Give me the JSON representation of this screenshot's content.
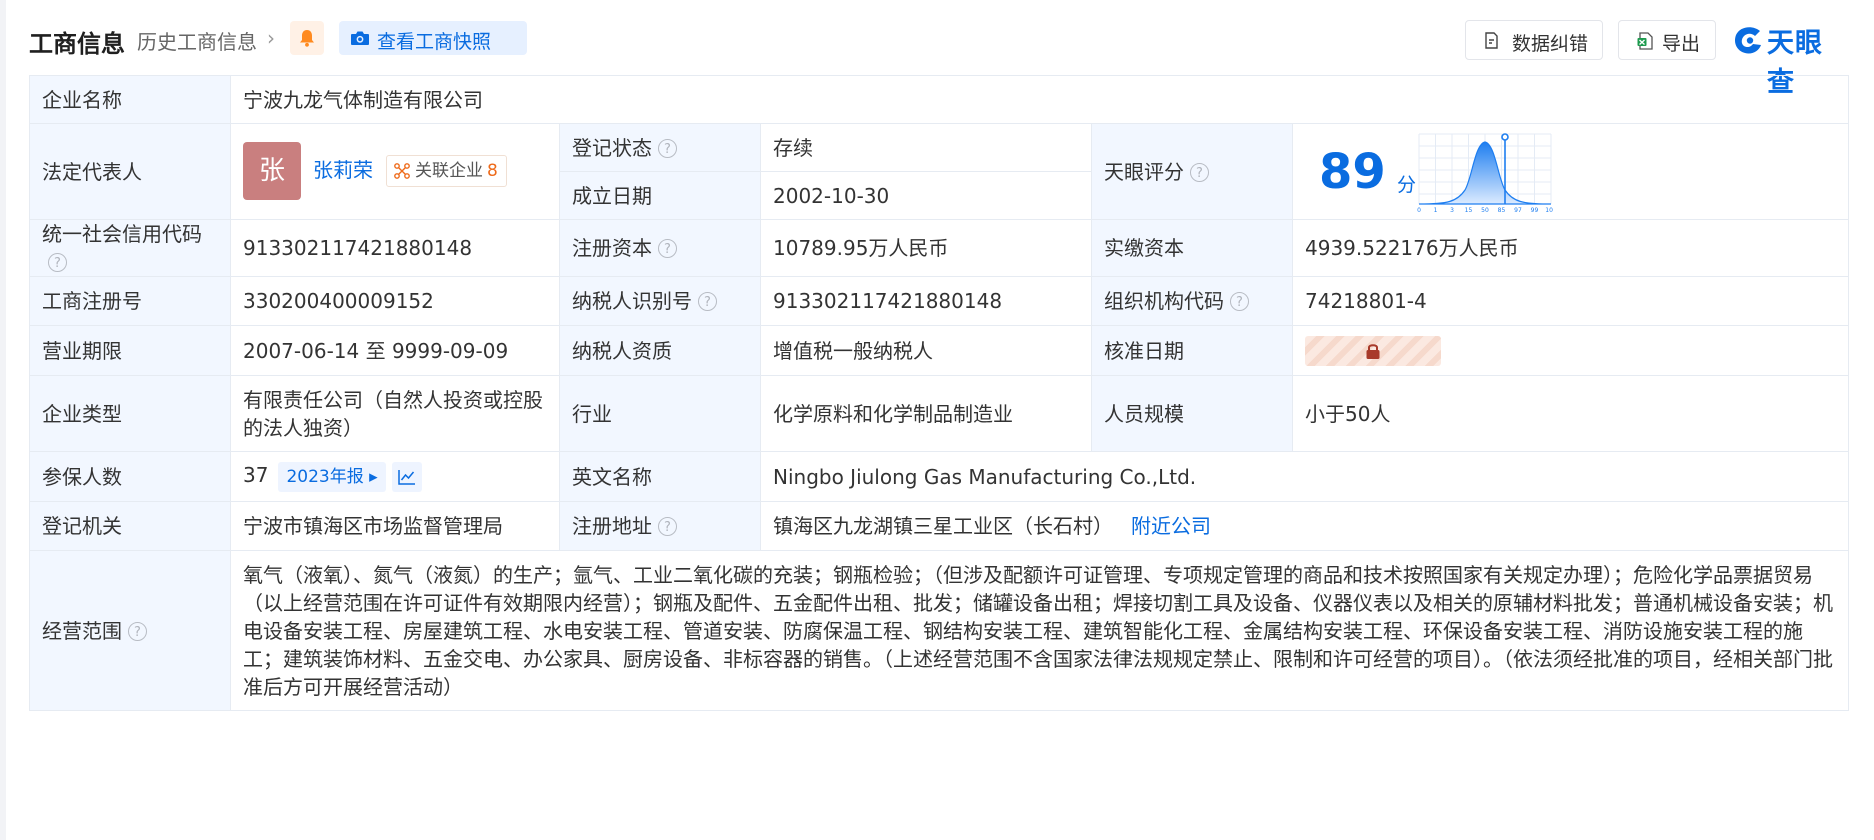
{
  "header": {
    "title": "工商信息",
    "history": "历史工商信息",
    "chevron": "›",
    "snapshot": "查看工商快照",
    "fix_btn": "数据纠错",
    "export_btn": "导出",
    "logo": "天眼查"
  },
  "colors": {
    "accent": "#0a6ce0",
    "status_green": "#2aa84a",
    "label_bg": "#f2f7ff",
    "badge_orange": "#ee6a1a"
  },
  "info": {
    "company_name_label": "企业名称",
    "company_name": "宁波九龙气体制造有限公司",
    "legal_rep_label": "法定代表人",
    "avatar_char": "张",
    "legal_rep": "张莉荣",
    "related_label": "关联企业",
    "related_count": "8",
    "status_label": "登记状态",
    "status": "存续",
    "founded_label": "成立日期",
    "founded": "2002-10-30",
    "score_label": "天眼评分",
    "score": "89",
    "score_unit": "分",
    "credit_code_label": "统一社会信用代码",
    "credit_code": "91330211742188014​8",
    "reg_capital_label": "注册资本",
    "reg_capital": "10789.95万人民币",
    "paid_capital_label": "实缴资本",
    "paid_capital": "4939.522176万人民币",
    "reg_no_label": "工商注册号",
    "reg_no": "330200400009152",
    "taxpayer_id_label": "纳税人识别号",
    "taxpayer_id": "913302117421880148",
    "org_code_label": "组织机构代码",
    "org_code": "74218801-4",
    "term_label": "营业期限",
    "term": "2007-06-14 至 9999-09-09",
    "taxpayer_type_label": "纳税人资质",
    "taxpayer_type": "增值税一般纳税人",
    "approval_label": "核准日期",
    "type_label": "企业类型",
    "type": "有限责任公司（自然人投资或控股的法人独资）",
    "industry_label": "行业",
    "industry": "化学原料和化学制品制造业",
    "staff_label": "人员规模",
    "staff": "小于50人",
    "insured_label": "参保人数",
    "insured": "37",
    "report_year": "2023年报",
    "en_name_label": "英文名称",
    "en_name": "Ningbo Jiulong Gas Manufacturing Co.,Ltd.",
    "authority_label": "登记机关",
    "authority": "宁波市镇海区市场监督管理局",
    "address_label": "注册地址",
    "address": "镇海区九龙湖镇三星工业区（长石村）",
    "nearby": "附近公司",
    "scope_label": "经营范围",
    "scope": "氧气（液氧）、氮气（液氮）的生产；氩气、工业二氧化碳的充装；钢瓶检验；（但涉及配额许可证管理、专项规定管理的商品和技术按照国家有关规定办理）；危险化学品票据贸易（以上经营范围在许可证件有效期限内经营）；钢瓶及配件、五金配件出租、批发；储罐设备出租；焊接切割工具及设备、仪器仪表以及相关的原辅材料批发；普通机械设备安装；机电设备安装工程、房屋建筑工程、水电安装工程、管道安装、防腐保温工程、钢结构安装工程、建筑智能化工程、金属结构安装工程、环保设备安装工程、消防设施安装工程的施工；建筑装饰材料、五金交电、办公家具、厨房设备、非标容器的销售。（上述经营范围不含国家法律法规规定禁止、限制和许可经营的项目）。（依法须经批准的项目，经相关部门批准后方可开展经营活动）"
  },
  "score_chart": {
    "ticks": [
      "0",
      "1",
      "3",
      "15",
      "50",
      "85",
      "97",
      "99",
      "100"
    ]
  }
}
